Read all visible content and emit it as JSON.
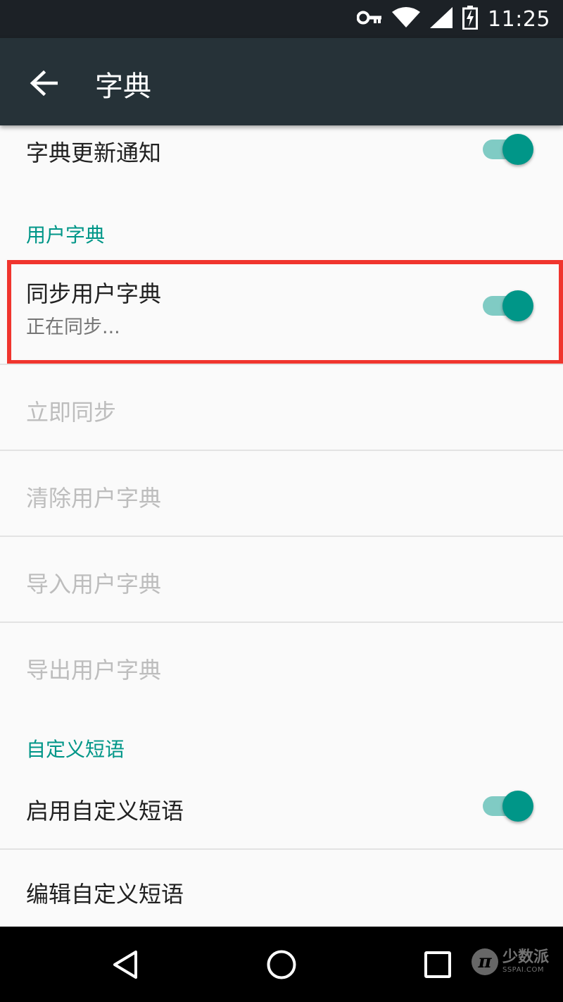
{
  "status_bar": {
    "time": "11:25",
    "icons": [
      "vpn-key-icon",
      "wifi-icon",
      "cellular-signal-icon",
      "battery-charging-icon"
    ]
  },
  "app_bar": {
    "title": "字典",
    "back_icon": "arrow-back-icon"
  },
  "settings": {
    "update_notification": {
      "title": "字典更新通知",
      "enabled": true
    },
    "user_dictionary_header": "用户字典",
    "sync_user_dictionary": {
      "title": "同步用户字典",
      "summary": "正在同步...",
      "enabled": true
    },
    "sync_now": {
      "title": "立即同步",
      "disabled": true
    },
    "clear_user_dictionary": {
      "title": "清除用户字典",
      "disabled": true
    },
    "import_user_dictionary": {
      "title": "导入用户字典",
      "disabled": true
    },
    "export_user_dictionary": {
      "title": "导出用户字典",
      "disabled": true
    },
    "custom_phrases_header": "自定义短语",
    "enable_custom_phrases": {
      "title": "启用自定义短语",
      "enabled": true
    },
    "edit_custom_phrases": {
      "title": "编辑自定义短语"
    }
  },
  "nav_bar": {
    "back": "nav-back-icon",
    "home": "nav-home-icon",
    "recents": "nav-recents-icon"
  },
  "watermark": {
    "logo_letter": "π",
    "name": "少数派",
    "site": "SSPAI.COM"
  },
  "colors": {
    "accent": "#009688",
    "accent_track": "#80cbc4",
    "app_bar": "#263238",
    "status_bar": "#1c2126",
    "highlight": "#f0352e"
  }
}
